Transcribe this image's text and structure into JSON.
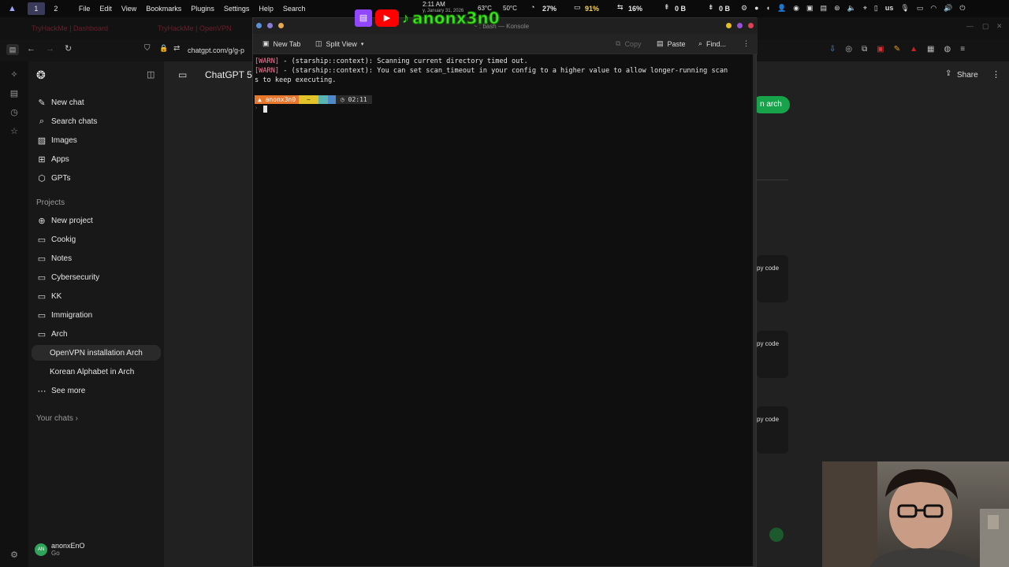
{
  "sysbar": {
    "workspaces": [
      "1",
      "2"
    ],
    "menus": [
      "File",
      "Edit",
      "View",
      "Bookmarks",
      "Plugins",
      "Settings",
      "Help",
      "Search"
    ],
    "time": "2:11 AM",
    "date": "y, January 31, 2026",
    "temp1": "63°C",
    "temp2": "50°C",
    "stat_cpu": "27%",
    "stat_mem": "91%",
    "stat_swap": "16%",
    "net_up": "0 B",
    "net_down": "0 B",
    "locale": "us"
  },
  "overlay": {
    "streamer": "anonx3n0"
  },
  "browser": {
    "tab1": "TryHackMe | Dashboard",
    "tab2": "TryHackMe | OpenVPN",
    "url": "chatgpt.com/g/g-p"
  },
  "sidebar": {
    "items": [
      {
        "label": "New chat",
        "icon": "new-chat-icon"
      },
      {
        "label": "Search chats",
        "icon": "search-icon"
      },
      {
        "label": "Images",
        "icon": "image-icon"
      },
      {
        "label": "Apps",
        "icon": "apps-icon"
      },
      {
        "label": "GPTs",
        "icon": "gpts-icon"
      }
    ],
    "projects_heading": "Projects",
    "projects": [
      {
        "label": "New project",
        "icon": "new-folder-icon"
      },
      {
        "label": "Cookig",
        "icon": "folder-icon"
      },
      {
        "label": "Notes",
        "icon": "folder-icon"
      },
      {
        "label": "Cybersecurity",
        "icon": "folder-icon"
      },
      {
        "label": "KK",
        "icon": "folder-icon"
      },
      {
        "label": "Immigration",
        "icon": "folder-icon"
      },
      {
        "label": "Arch",
        "icon": "folder-open-icon"
      }
    ],
    "arch_chats": [
      "OpenVPN installation Arch",
      "Korean Alphabet in Arch"
    ],
    "see_more": "See more",
    "your_chats": "Your chats ›",
    "user_name": "anonxEnO",
    "user_plan": "Go",
    "user_initials": "AN"
  },
  "main": {
    "title": "ChatGPT 5",
    "share": "Share",
    "arch_pill": "n arch",
    "copy_label": "py code"
  },
  "terminal": {
    "title": "~ : bash — Konsole",
    "new_tab": "New Tab",
    "split_view": "Split View",
    "copy": "Copy",
    "paste": "Paste",
    "find": "Find...",
    "line1_tag": "[WARN]",
    "line1": " - (starship::context): Scanning current directory timed out.",
    "line2_tag": "[WARN]",
    "line2": " - (starship::context): You can set scan_timeout in your config to a higher value to allow longer-running scan",
    "line3": "s to keep executing.",
    "prompt_user": "anonx3n0",
    "prompt_dir": "~",
    "prompt_time": "02:11"
  },
  "colors": {
    "twitch": "#9146ff",
    "youtube": "#ff0000",
    "overlay_text": "#39e61a",
    "prompt_orange": "#e8772e",
    "prompt_yellow": "#e2c32a",
    "warn": "#ff7a9c",
    "accent_green": "#16a34a"
  }
}
